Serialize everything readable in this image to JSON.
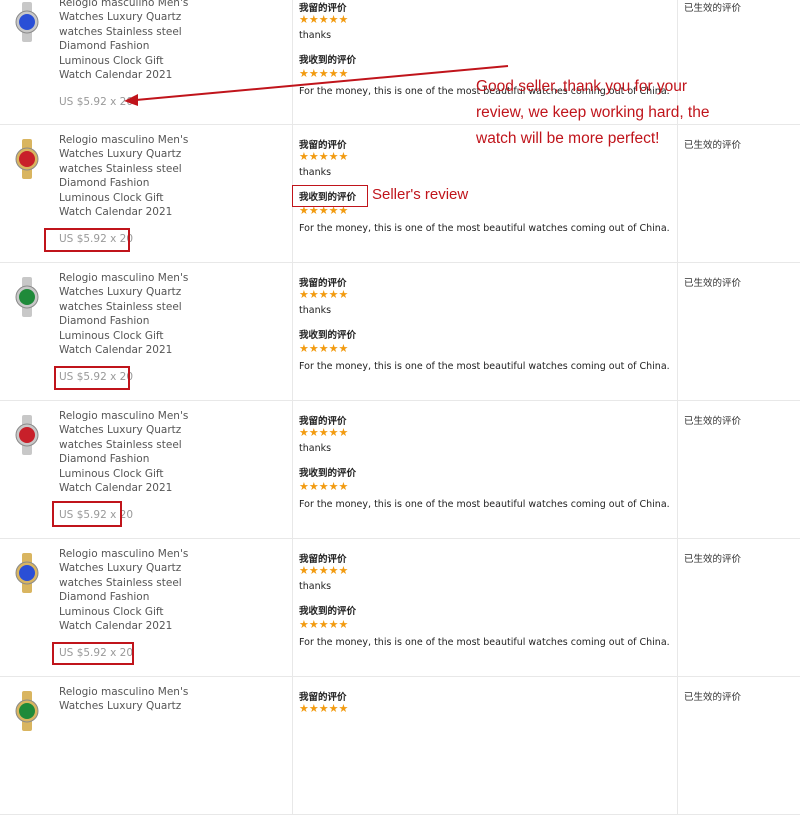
{
  "rows": [
    {
      "product": {
        "title_lines": [
          "Relogio masculino Men's",
          "Watches Luxury Quartz",
          "watches Stainless steel",
          "Diamond Fashion",
          "Luminous Clock Gift",
          "Watch Calendar 2021"
        ],
        "price": "US $5.92 x 20",
        "watch_color": "#2a4fd6",
        "band_color": "#c8c8c8"
      },
      "my_review": {
        "label": "我留的评价",
        "stars": "★★★★★",
        "text": "thanks"
      },
      "received_review": {
        "label": "我收到的评价",
        "stars": "★★★★★",
        "text": "For the money, this is one of the most beautiful watches coming out of China."
      },
      "status": "已生效的评价"
    },
    {
      "product": {
        "title_lines": [
          "Relogio masculino Men's",
          "Watches Luxury Quartz",
          "watches Stainless steel",
          "Diamond Fashion",
          "Luminous Clock Gift",
          "Watch Calendar 2021"
        ],
        "price": "US $5.92 x 20",
        "watch_color": "#c8202a",
        "band_color": "#d9b560"
      },
      "my_review": {
        "label": "我留的评价",
        "stars": "★★★★★",
        "text": "thanks"
      },
      "received_review": {
        "label": "我收到的评价",
        "stars": "★★★★★",
        "text": "For the money, this is one of the most beautiful watches coming out of China."
      },
      "status": "已生效的评价"
    },
    {
      "product": {
        "title_lines": [
          "Relogio masculino Men's",
          "Watches Luxury Quartz",
          "watches Stainless steel",
          "Diamond Fashion",
          "Luminous Clock Gift",
          "Watch Calendar 2021"
        ],
        "price": "US $5.92 x 20",
        "watch_color": "#1f8a3a",
        "band_color": "#c8c8c8"
      },
      "my_review": {
        "label": "我留的评价",
        "stars": "★★★★★",
        "text": "thanks"
      },
      "received_review": {
        "label": "我收到的评价",
        "stars": "★★★★★",
        "text": "For the money, this is one of the most beautiful watches coming out of China."
      },
      "status": "已生效的评价"
    },
    {
      "product": {
        "title_lines": [
          "Relogio masculino Men's",
          "Watches Luxury Quartz",
          "watches Stainless steel",
          "Diamond Fashion",
          "Luminous Clock Gift",
          "Watch Calendar 2021"
        ],
        "price": "US $5.92 x 20",
        "watch_color": "#c8202a",
        "band_color": "#c8c8c8"
      },
      "my_review": {
        "label": "我留的评价",
        "stars": "★★★★★",
        "text": "thanks"
      },
      "received_review": {
        "label": "我收到的评价",
        "stars": "★★★★★",
        "text": "For the money, this is one of the most beautiful watches coming out of China."
      },
      "status": "已生效的评价"
    },
    {
      "product": {
        "title_lines": [
          "Relogio masculino Men's",
          "Watches Luxury Quartz",
          "watches Stainless steel",
          "Diamond Fashion",
          "Luminous Clock Gift",
          "Watch Calendar 2021"
        ],
        "price": "US $5.92 x 20",
        "watch_color": "#2a4fd6",
        "band_color": "#d9b560"
      },
      "my_review": {
        "label": "我留的评价",
        "stars": "★★★★★",
        "text": "thanks"
      },
      "received_review": {
        "label": "我收到的评价",
        "stars": "★★★★★",
        "text": "For the money, this is one of the most beautiful watches coming out of China."
      },
      "status": "已生效的评价"
    },
    {
      "product": {
        "title_lines": [
          "Relogio masculino Men's",
          "Watches Luxury Quartz"
        ],
        "price": "",
        "watch_color": "#1f8a3a",
        "band_color": "#d9b560"
      },
      "my_review": {
        "label": "我留的评价",
        "stars": "★★★★★",
        "text": ""
      },
      "received_review": {
        "label": "",
        "stars": "",
        "text": ""
      },
      "status": "已生效的评价"
    }
  ],
  "annotations": {
    "main_note": [
      "Good seller, thank you for your",
      "review, we keep working hard, the",
      "watch will be more perfect!"
    ],
    "seller_note": "Seller's review"
  },
  "colors": {
    "accent": "#c0141b",
    "stars": "#f29b10"
  }
}
